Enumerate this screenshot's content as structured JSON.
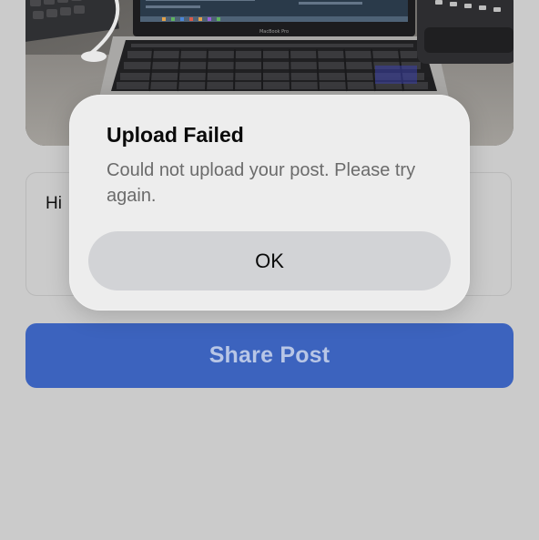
{
  "post": {
    "image_alt": "Photo of a MacBook Pro laptop on a desk",
    "laptop_brand_text": "MacBook Pro",
    "caption_value": "Hi"
  },
  "share_button": {
    "label": "Share Post",
    "color": "#3c63be"
  },
  "alert": {
    "title": "Upload Failed",
    "message": "Could not upload your post. Please try again.",
    "ok_label": "OK"
  }
}
